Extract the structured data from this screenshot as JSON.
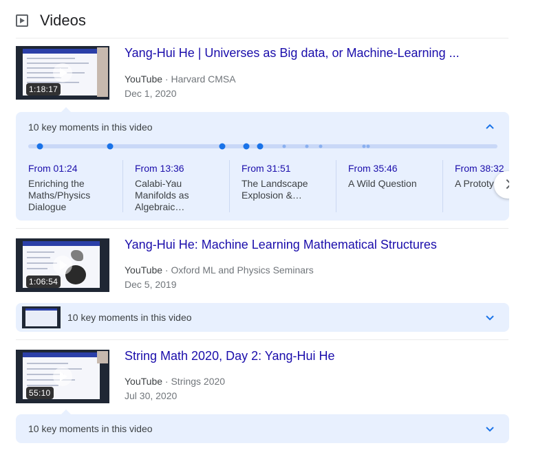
{
  "section": {
    "title": "Videos",
    "icon": "play-box-icon"
  },
  "videos": [
    {
      "title": "Yang-Hui He | Universes as Big data, or Machine-Learning ...",
      "platform": "YouTube",
      "separator": "·",
      "channel": "Harvard CMSA",
      "date": "Dec 1, 2020",
      "duration": "1:18:17",
      "key_moments": {
        "header": "10 key moments in this video",
        "expanded": true,
        "items": [
          {
            "time": "From 01:24",
            "label": "Enriching the Maths/Physics Dialogue"
          },
          {
            "time": "From 13:36",
            "label": "Calabi-Yau Manifolds as Algebraic…"
          },
          {
            "time": "From 31:51",
            "label": "The Landscape Explosion &…"
          },
          {
            "time": "From 35:46",
            "label": "A Wild Question"
          },
          {
            "time": "From 38:32",
            "label": "A Prototy Question"
          }
        ]
      }
    },
    {
      "title": "Yang-Hui He: Machine Learning Mathematical Structures",
      "platform": "YouTube",
      "separator": "·",
      "channel": "Oxford ML and Physics Seminars",
      "date": "Dec 5, 2019",
      "duration": "1:06:54",
      "key_moments": {
        "header": "10 key moments in this video",
        "expanded": false
      }
    },
    {
      "title": "String Math 2020, Day 2: Yang-Hui He",
      "platform": "YouTube",
      "separator": "·",
      "channel": "Strings 2020",
      "date": "Jul 30, 2020",
      "duration": "55:10",
      "key_moments": {
        "header": "10 key moments in this video",
        "expanded": false
      }
    }
  ],
  "colors": {
    "link": "#1a0dab",
    "accent": "#1a73e8",
    "panel_bg": "#e8f0fe"
  }
}
